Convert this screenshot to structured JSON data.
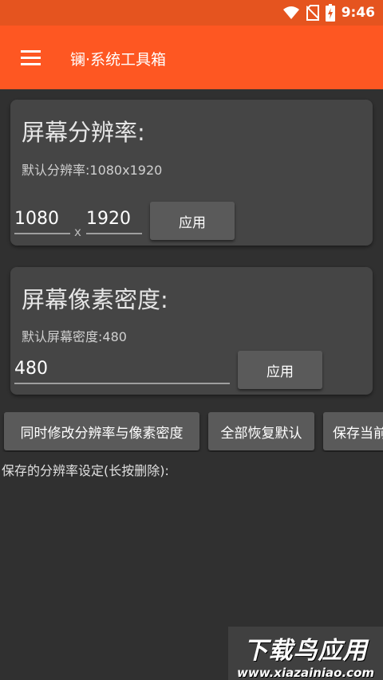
{
  "status_bar": {
    "time": "9:46",
    "icons": [
      "wifi-icon",
      "no-sim-icon",
      "battery-charging-icon"
    ]
  },
  "app_bar": {
    "title": "镧·系统工具箱",
    "menu_icon": "hamburger-menu-icon"
  },
  "resolution_card": {
    "title": "屏幕分辨率:",
    "default_text": "默认分辨率:1080x1920",
    "width_value": "1080",
    "separator": "x",
    "height_value": "1920",
    "apply_label": "应用"
  },
  "density_card": {
    "title": "屏幕像素密度:",
    "default_text": "默认屏幕密度:480",
    "density_value": "480",
    "apply_label": "应用"
  },
  "actions": {
    "modify_both_label": "同时修改分辨率与像素密度",
    "restore_default_label": "全部恢复默认",
    "save_current_label": "保存当前"
  },
  "saved_settings": {
    "label": "保存的分辨率设定(长按删除):"
  },
  "watermark": {
    "title": "下载鸟应用",
    "url": "www.xiazainiao.com"
  },
  "colors": {
    "accent": "#fe5722",
    "status_bar": "#e5541f",
    "background": "#303030",
    "card": "#454545",
    "button": "#5a5a5a"
  }
}
